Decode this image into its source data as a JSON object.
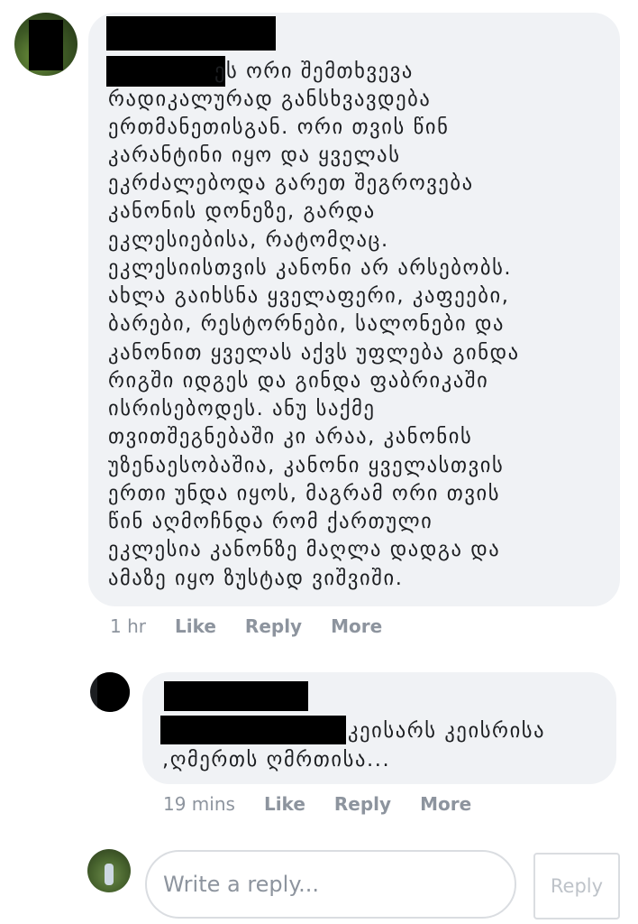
{
  "comment": {
    "author_name": "",
    "text_lines": [
      "ეს ორი შემთხვევა",
      "რადიკალურად განსხვავდება",
      "ერთმანეთისგან. ორი თვის წინ",
      "კარანტინი იყო და ყველას",
      "ეკრძალებოდა გარეთ შეგროვება",
      "კანონის დონეზე, გარდა",
      "ეკლესიებისა, რატომღაც.",
      "ეკლესიისთვის კანონი არ არსებობს.",
      "ახლა გაიხსნა ყველაფერი, კაფეები,",
      "ბარები, რესტორნები, სალონები და",
      "კანონით ყველას აქვს უფლება გინდა",
      "რიგში იდგეს და გინდა ფაბრიკაში",
      "ისრისებოდეს. ანუ საქმე",
      "თვითშეგნებაში კი არაა, კანონის",
      "უზენაესობაშია, კანონი ყველასთვის",
      "ერთი უნდა იყოს, მაგრამ ორი თვის",
      "წინ აღმოჩნდა რომ ქართული",
      "ეკლესია კანონზე მაღლა დადგა და",
      "ამაზე იყო ზუსტად ვიშვიში."
    ],
    "time": "1 hr",
    "like_label": "Like",
    "reply_label": "Reply",
    "more_label": "More"
  },
  "reply": {
    "author_name": "",
    "text_lines": [
      "კეისარს კეისრისა",
      ",ღმერთს ღმრთისა..."
    ],
    "time": "19 mins",
    "like_label": "Like",
    "reply_label": "Reply",
    "more_label": "More"
  },
  "composer": {
    "placeholder": "Write a reply...",
    "button_label": "Reply"
  }
}
